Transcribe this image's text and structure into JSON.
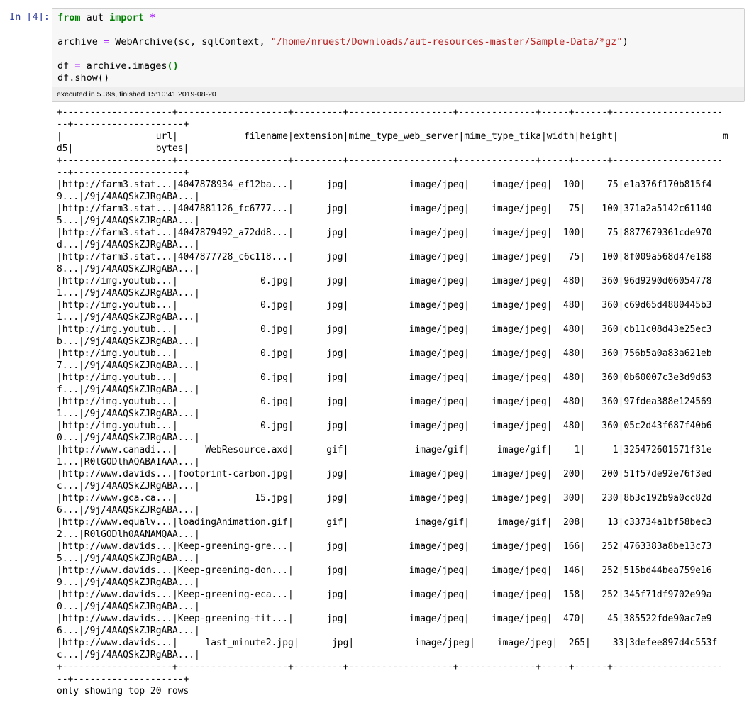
{
  "cell": {
    "prompt": "In [4]:",
    "code_lines": [
      [
        {
          "t": "kw",
          "v": "from"
        },
        {
          "t": "fn",
          "v": " aut "
        },
        {
          "t": "kw",
          "v": "import"
        },
        {
          "t": "fn",
          "v": " "
        },
        {
          "t": "op",
          "v": "*"
        }
      ],
      [],
      [
        {
          "t": "fn",
          "v": "archive "
        },
        {
          "t": "op",
          "v": "="
        },
        {
          "t": "fn",
          "v": " WebArchive(sc, sqlContext, "
        },
        {
          "t": "str",
          "v": "\"/home/nruest/Downloads/aut-resources-master/Sample-Data/*gz\""
        },
        {
          "t": "fn",
          "v": ")"
        }
      ],
      [],
      [
        {
          "t": "fn",
          "v": "df "
        },
        {
          "t": "op",
          "v": "="
        },
        {
          "t": "fn",
          "v": " archive.images"
        },
        {
          "t": "kw",
          "v": "()"
        }
      ],
      [
        {
          "t": "fn",
          "v": "df.show()"
        }
      ]
    ],
    "exec_info": "executed in 5.39s, finished 15:10:41 2019-08-20"
  },
  "output": {
    "lines": [
      "+--------------------+--------------------+---------+-------------------+--------------+-----+------+--------------------",
      "--+--------------------+",
      "|                 url|            filename|extension|mime_type_web_server|mime_type_tika|width|height|                   m",
      "d5|               bytes|",
      "+--------------------+--------------------+---------+-------------------+--------------+-----+------+--------------------",
      "--+--------------------+",
      "|http://farm3.stat...|4047878934_ef12ba...|      jpg|           image/jpeg|    image/jpeg|  100|    75|e1a376f170b815f4",
      "9...|/9j/4AAQSkZJRgABA...|",
      "|http://farm3.stat...|4047881126_fc6777...|      jpg|           image/jpeg|    image/jpeg|   75|   100|371a2a5142c61140",
      "5...|/9j/4AAQSkZJRgABA...|",
      "|http://farm3.stat...|4047879492_a72dd8...|      jpg|           image/jpeg|    image/jpeg|  100|    75|8877679361cde970",
      "d...|/9j/4AAQSkZJRgABA...|",
      "|http://farm3.stat...|4047877728_c6c118...|      jpg|           image/jpeg|    image/jpeg|   75|   100|8f009a568d47e188",
      "8...|/9j/4AAQSkZJRgABA...|",
      "|http://img.youtub...|               0.jpg|      jpg|           image/jpeg|    image/jpeg|  480|   360|96d9290d06054778",
      "1...|/9j/4AAQSkZJRgABA...|",
      "|http://img.youtub...|               0.jpg|      jpg|           image/jpeg|    image/jpeg|  480|   360|c69d65d4880445b3",
      "1...|/9j/4AAQSkZJRgABA...|",
      "|http://img.youtub...|               0.jpg|      jpg|           image/jpeg|    image/jpeg|  480|   360|cb11c08d43e25ec3",
      "b...|/9j/4AAQSkZJRgABA...|",
      "|http://img.youtub...|               0.jpg|      jpg|           image/jpeg|    image/jpeg|  480|   360|756b5a0a83a621eb",
      "7...|/9j/4AAQSkZJRgABA...|",
      "|http://img.youtub...|               0.jpg|      jpg|           image/jpeg|    image/jpeg|  480|   360|0b60007c3e3d9d63",
      "f...|/9j/4AAQSkZJRgABA...|",
      "|http://img.youtub...|               0.jpg|      jpg|           image/jpeg|    image/jpeg|  480|   360|97fdea388e124569",
      "1...|/9j/4AAQSkZJRgABA...|",
      "|http://img.youtub...|               0.jpg|      jpg|           image/jpeg|    image/jpeg|  480|   360|05c2d43f687f40b6",
      "0...|/9j/4AAQSkZJRgABA...|",
      "|http://www.canadi...|     WebResource.axd|      gif|            image/gif|     image/gif|    1|     1|325472601571f31e",
      "1...|R0lGODlhAQABAIAAA...|",
      "|http://www.davids...|footprint-carbon.jpg|      jpg|           image/jpeg|    image/jpeg|  200|   200|51f57de92e76f3ed",
      "c...|/9j/4AAQSkZJRgABA...|",
      "|http://www.gca.ca...|              15.jpg|      jpg|           image/jpeg|    image/jpeg|  300|   230|8b3c192b9a0cc82d",
      "6...|/9j/4AAQSkZJRgABA...|",
      "|http://www.equalv...|loadingAnimation.gif|      gif|            image/gif|     image/gif|  208|    13|c33734a1bf58bec3",
      "2...|R0lGODlh0AANAMQAA...|",
      "|http://www.davids...|Keep-greening-gre...|      jpg|           image/jpeg|    image/jpeg|  166|   252|4763383a8be13c73",
      "5...|/9j/4AAQSkZJRgABA...|",
      "|http://www.davids...|Keep-greening-don...|      jpg|           image/jpeg|    image/jpeg|  146|   252|515bd44bea759e16",
      "9...|/9j/4AAQSkZJRgABA...|",
      "|http://www.davids...|Keep-greening-eca...|      jpg|           image/jpeg|    image/jpeg|  158|   252|345f71df9702e99a",
      "0...|/9j/4AAQSkZJRgABA...|",
      "|http://www.davids...|Keep-greening-tit...|      jpg|           image/jpeg|    image/jpeg|  470|    45|385522fde90ac7e9",
      "6...|/9j/4AAQSkZJRgABA...|",
      "|http://www.davids...|     last_minute2.jpg|      jpg|           image/jpeg|    image/jpeg|  265|    33|3defee897d4c553f",
      "c...|/9j/4AAQSkZJRgABA...|",
      "+--------------------+--------------------+---------+-------------------+--------------+-----+------+--------------------",
      "--+--------------------+",
      "only showing top 20 rows"
    ]
  }
}
